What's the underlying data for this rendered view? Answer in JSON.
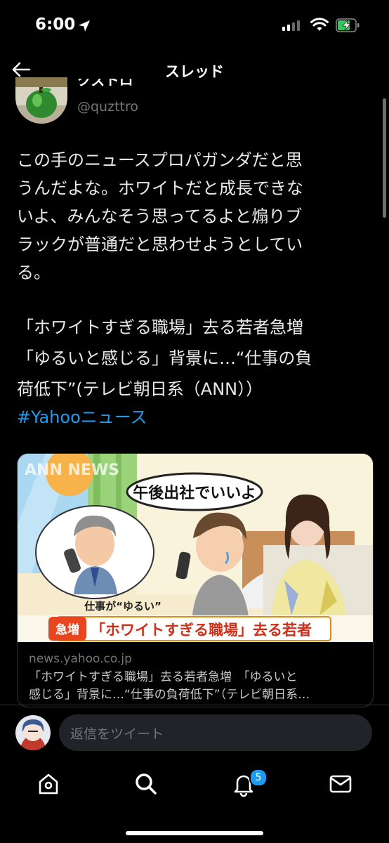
{
  "status_bar": {
    "time": "6:00"
  },
  "header": {
    "title": "スレッド"
  },
  "author": {
    "name": "クズトロ",
    "handle": "@quzttro"
  },
  "tweet": {
    "text": "この手のニュースプロパガンダだと思\nうんだよな。ホワイトだと成長できな\nいよ、みんなそう思ってるよと煽りブ\nラックが普通だと思わせようとしてい\nる。",
    "quote": "「ホワイトすぎる職場」去る若者急増\n「ゆるいと感じる」背景に…“仕事の負\n荷低下”(テレビ朝日系（ANN））",
    "hashtag": "#Yahooニュース"
  },
  "card": {
    "image": {
      "logo": "ANN NEWS",
      "speech": "午後出社でいいよ",
      "caption": "仕事が“ゆるい”",
      "tag": "急増",
      "banner": "「ホワイトすぎる職場」去る若者"
    },
    "domain": "news.yahoo.co.jp",
    "title": "「ホワイトすぎる職場」去る若者急増　「ゆるいと\n感じる」背景に…“仕事の負荷低下”（テレビ朝日系…"
  },
  "reply": {
    "placeholder": "返信をツイート"
  },
  "nav": {
    "notifications_badge": "5",
    "items": [
      "home-icon",
      "search-icon",
      "notifications-icon",
      "messages-icon"
    ]
  },
  "colors": {
    "accent": "#1d9bf0",
    "background": "#000000",
    "muted": "#71767b"
  }
}
